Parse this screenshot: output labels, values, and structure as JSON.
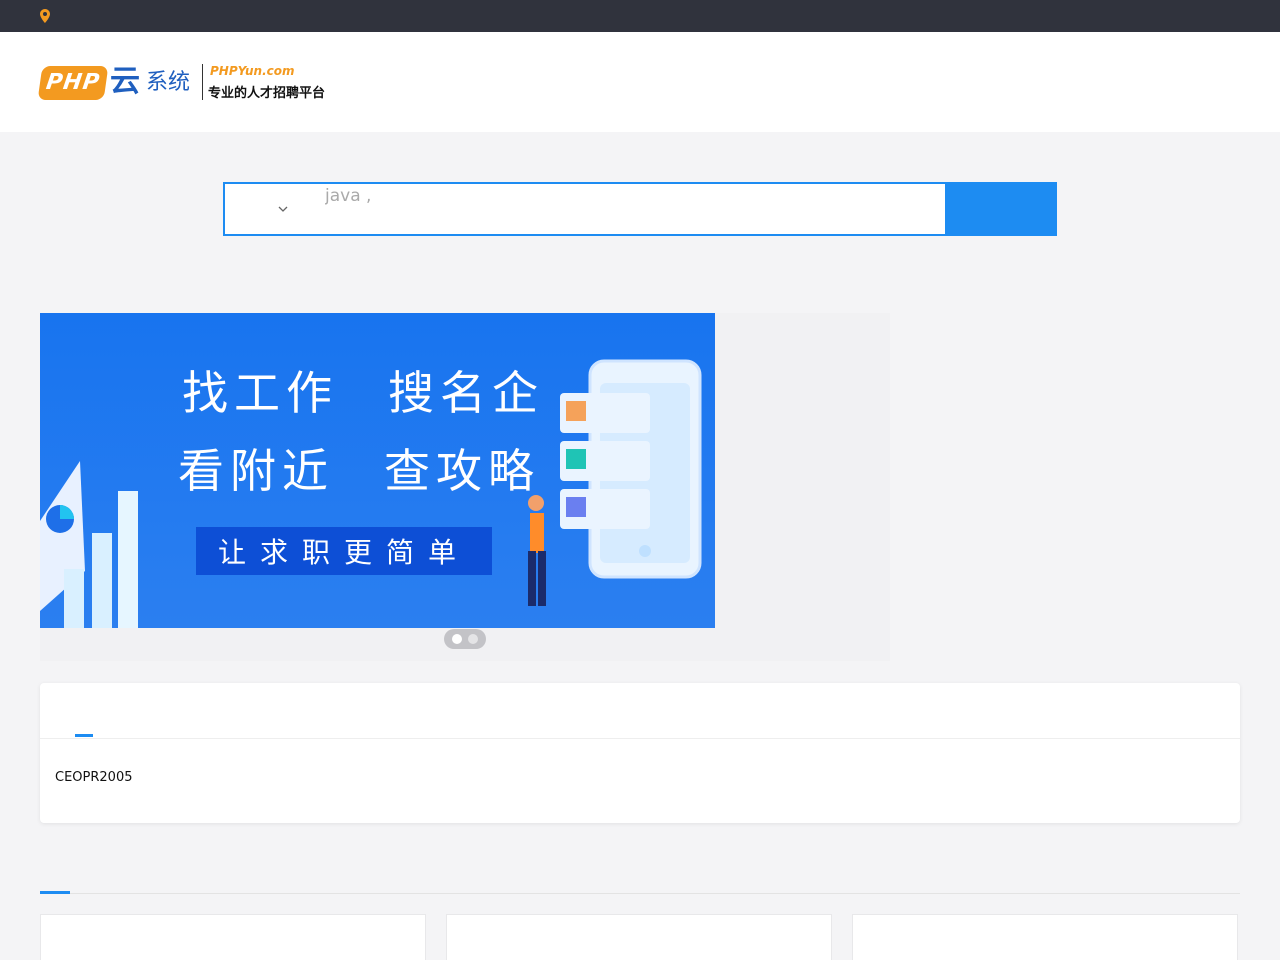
{
  "topbar": {
    "location": "",
    "right_text": ""
  },
  "logo": {
    "php": "PHP",
    "yun": "云",
    "xitong": "系统",
    "domain": "PHPYun.com",
    "slogan": "专业的人才招聘平台"
  },
  "nav": [
    "",
    "",
    "",
    "",
    "",
    "",
    "",
    "",
    "",
    "",
    "",
    "",
    ""
  ],
  "search": {
    "type_label": "",
    "placeholder": "java ,",
    "button_label": ""
  },
  "hot_label": "",
  "banner": {
    "line1a": "找工作",
    "line1b": "搜名企",
    "line2a": "看附近",
    "line2b": "查攻略",
    "cta": "让求职更简单"
  },
  "intro": {
    "title": "",
    "body": "CEOPR2005"
  },
  "tabs": [
    "",
    "",
    ""
  ],
  "cards": [
    "",
    "",
    ""
  ],
  "colors": {
    "accent": "#1d8cf2",
    "topbar": "#30333d",
    "logo_orange": "#f39a20",
    "logo_blue": "#1f5fbf"
  }
}
